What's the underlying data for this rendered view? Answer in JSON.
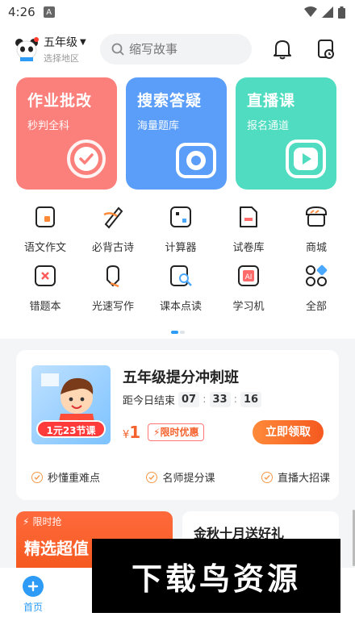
{
  "status_bar": {
    "time": "4:26",
    "app_badge": "A"
  },
  "header": {
    "grade": "五年级",
    "region": "选择地区",
    "search_placeholder": "缩写故事"
  },
  "feature_cards": [
    {
      "title": "作业批改",
      "subtitle": "秒判全科",
      "color": "#fb7f7a",
      "icon": "check-circle-icon"
    },
    {
      "title": "搜索答疑",
      "subtitle": "海量题库",
      "color": "#5b9ef9",
      "icon": "camera-icon"
    },
    {
      "title": "直播课",
      "subtitle": "报名通道",
      "color": "#4fdcc0",
      "icon": "play-icon"
    }
  ],
  "tools": [
    {
      "label": "语文作文",
      "icon": "essay-icon"
    },
    {
      "label": "必背古诗",
      "icon": "poem-icon"
    },
    {
      "label": "计算器",
      "icon": "calculator-icon"
    },
    {
      "label": "试卷库",
      "icon": "exam-icon"
    },
    {
      "label": "商城",
      "icon": "store-icon"
    },
    {
      "label": "错题本",
      "icon": "mistake-book-icon"
    },
    {
      "label": "光速写作",
      "icon": "pen-icon"
    },
    {
      "label": "课本点读",
      "icon": "textbook-read-icon"
    },
    {
      "label": "学习机",
      "icon": "ai-device-icon"
    },
    {
      "label": "全部",
      "icon": "all-grid-icon"
    }
  ],
  "promo": {
    "title": "五年级提分冲刺班",
    "countdown_label": "距今日结束",
    "hours": "07",
    "minutes": "33",
    "seconds": "16",
    "cover_tag": "1元23节课",
    "currency": "¥",
    "price": "1",
    "limited_label": "限时优惠",
    "cta": "立即领取",
    "features": [
      "秒懂重难点",
      "名师提分课",
      "直播大招课"
    ]
  },
  "flash_sale": {
    "tag": "限时抢",
    "title": "精选超值"
  },
  "gift": {
    "title": "金秋十月送好礼"
  },
  "tabbar": {
    "home": "首页"
  },
  "watermark": "下载鸟资源",
  "colors": {
    "accent": "#2e9cf7",
    "orange": "#f5591f"
  }
}
